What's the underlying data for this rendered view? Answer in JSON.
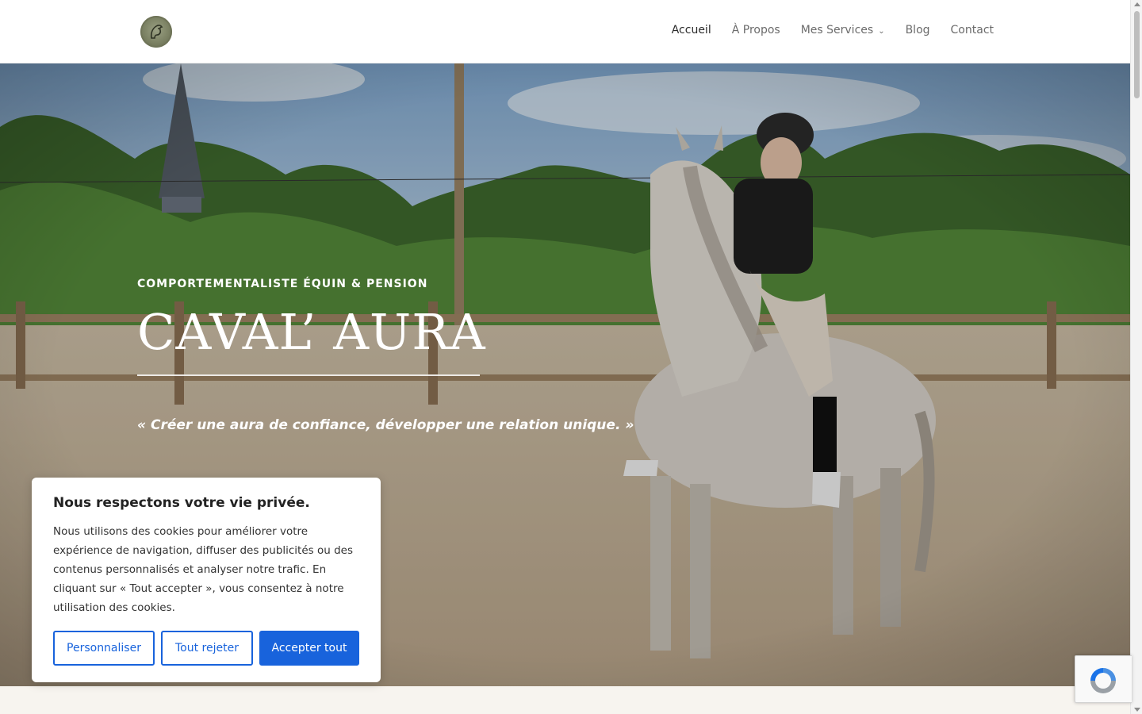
{
  "header": {
    "logo_alt": "Caval' Aura",
    "nav": [
      {
        "label": "Accueil",
        "active": true
      },
      {
        "label": "À Propos",
        "active": false
      },
      {
        "label": "Mes Services",
        "active": false,
        "has_dropdown": true
      },
      {
        "label": "Blog",
        "active": false
      },
      {
        "label": "Contact",
        "active": false
      }
    ]
  },
  "hero": {
    "eyebrow": "COMPORTEMENTALISTE ÉQUIN & PENSION",
    "title": "CAVAL’ AURA",
    "quote": "« Créer une aura de confiance, développer une relation unique. »"
  },
  "cookie": {
    "title": "Nous respectons votre vie privée.",
    "body": "Nous utilisons des cookies pour améliorer votre expérience de navigation, diffuser des publicités ou des contenus personnalisés et analyser notre trafic. En cliquant sur « Tout accepter », vous consentez à notre utilisation des cookies.",
    "customize_label": "Personnaliser",
    "reject_label": "Tout rejeter",
    "accept_label": "Accepter tout"
  },
  "colors": {
    "accent": "#1863dc",
    "nav_text": "#6b6b6b",
    "nav_active": "#2b2b2b",
    "strip": "#f7f4ef"
  },
  "icons": {
    "logo": "horse-head-logo-icon",
    "dropdown": "chevron-down-icon",
    "recaptcha": "recaptcha-icon"
  }
}
